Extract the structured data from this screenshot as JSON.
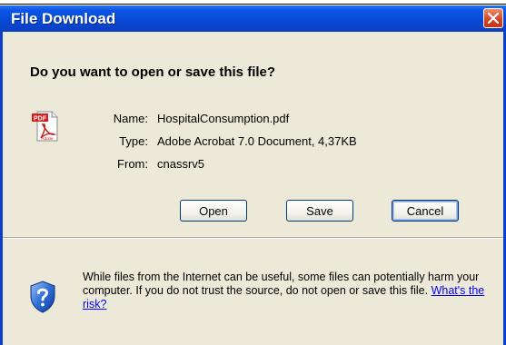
{
  "dialog": {
    "title": "File Download",
    "question": "Do you want to open or save this file?"
  },
  "file": {
    "name_label": "Name:",
    "name_value": "HospitalConsumption.pdf",
    "type_label": "Type:",
    "type_value": "Adobe Acrobat 7.0 Document, 4,37KB",
    "from_label": "From:",
    "from_value": "cnassrv5",
    "icon": "pdf-file-icon",
    "icon_text_top": "PDF",
    "icon_text_bottom": "Adobe"
  },
  "buttons": {
    "open": "Open",
    "save": "Save",
    "cancel": "Cancel"
  },
  "warning": {
    "icon": "shield-question-icon",
    "text": "While files from the Internet can be useful, some files can potentially harm your computer. If you do not trust the source, do not open or save this file. ",
    "link": "What's the risk?"
  },
  "colors": {
    "titlebar": "#0848d6",
    "client_bg": "#ece9d8",
    "close_button": "#d6452a",
    "link": "#0000ff"
  }
}
